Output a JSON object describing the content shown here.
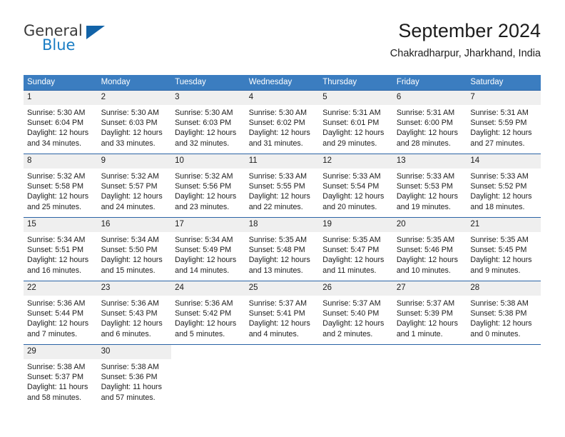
{
  "brand": {
    "name_part1": "General",
    "name_part2": "Blue",
    "triangle_color": "#1263a8",
    "blue_color": "#1a7dc4"
  },
  "header": {
    "title": "September 2024",
    "subtitle": "Chakradharpur, Jharkhand, India"
  },
  "theme": {
    "header_bg": "#3b7dc0",
    "row_border": "#2a63a5",
    "daynum_bg": "#efefef",
    "text": "#1c1c1c"
  },
  "weekday_headers": [
    "Sunday",
    "Monday",
    "Tuesday",
    "Wednesday",
    "Thursday",
    "Friday",
    "Saturday"
  ],
  "weeks": [
    [
      {
        "day": "1",
        "sunrise": "Sunrise: 5:30 AM",
        "sunset": "Sunset: 6:04 PM",
        "daylight": "Daylight: 12 hours and 34 minutes."
      },
      {
        "day": "2",
        "sunrise": "Sunrise: 5:30 AM",
        "sunset": "Sunset: 6:03 PM",
        "daylight": "Daylight: 12 hours and 33 minutes."
      },
      {
        "day": "3",
        "sunrise": "Sunrise: 5:30 AM",
        "sunset": "Sunset: 6:03 PM",
        "daylight": "Daylight: 12 hours and 32 minutes."
      },
      {
        "day": "4",
        "sunrise": "Sunrise: 5:30 AM",
        "sunset": "Sunset: 6:02 PM",
        "daylight": "Daylight: 12 hours and 31 minutes."
      },
      {
        "day": "5",
        "sunrise": "Sunrise: 5:31 AM",
        "sunset": "Sunset: 6:01 PM",
        "daylight": "Daylight: 12 hours and 29 minutes."
      },
      {
        "day": "6",
        "sunrise": "Sunrise: 5:31 AM",
        "sunset": "Sunset: 6:00 PM",
        "daylight": "Daylight: 12 hours and 28 minutes."
      },
      {
        "day": "7",
        "sunrise": "Sunrise: 5:31 AM",
        "sunset": "Sunset: 5:59 PM",
        "daylight": "Daylight: 12 hours and 27 minutes."
      }
    ],
    [
      {
        "day": "8",
        "sunrise": "Sunrise: 5:32 AM",
        "sunset": "Sunset: 5:58 PM",
        "daylight": "Daylight: 12 hours and 25 minutes."
      },
      {
        "day": "9",
        "sunrise": "Sunrise: 5:32 AM",
        "sunset": "Sunset: 5:57 PM",
        "daylight": "Daylight: 12 hours and 24 minutes."
      },
      {
        "day": "10",
        "sunrise": "Sunrise: 5:32 AM",
        "sunset": "Sunset: 5:56 PM",
        "daylight": "Daylight: 12 hours and 23 minutes."
      },
      {
        "day": "11",
        "sunrise": "Sunrise: 5:33 AM",
        "sunset": "Sunset: 5:55 PM",
        "daylight": "Daylight: 12 hours and 22 minutes."
      },
      {
        "day": "12",
        "sunrise": "Sunrise: 5:33 AM",
        "sunset": "Sunset: 5:54 PM",
        "daylight": "Daylight: 12 hours and 20 minutes."
      },
      {
        "day": "13",
        "sunrise": "Sunrise: 5:33 AM",
        "sunset": "Sunset: 5:53 PM",
        "daylight": "Daylight: 12 hours and 19 minutes."
      },
      {
        "day": "14",
        "sunrise": "Sunrise: 5:33 AM",
        "sunset": "Sunset: 5:52 PM",
        "daylight": "Daylight: 12 hours and 18 minutes."
      }
    ],
    [
      {
        "day": "15",
        "sunrise": "Sunrise: 5:34 AM",
        "sunset": "Sunset: 5:51 PM",
        "daylight": "Daylight: 12 hours and 16 minutes."
      },
      {
        "day": "16",
        "sunrise": "Sunrise: 5:34 AM",
        "sunset": "Sunset: 5:50 PM",
        "daylight": "Daylight: 12 hours and 15 minutes."
      },
      {
        "day": "17",
        "sunrise": "Sunrise: 5:34 AM",
        "sunset": "Sunset: 5:49 PM",
        "daylight": "Daylight: 12 hours and 14 minutes."
      },
      {
        "day": "18",
        "sunrise": "Sunrise: 5:35 AM",
        "sunset": "Sunset: 5:48 PM",
        "daylight": "Daylight: 12 hours and 13 minutes."
      },
      {
        "day": "19",
        "sunrise": "Sunrise: 5:35 AM",
        "sunset": "Sunset: 5:47 PM",
        "daylight": "Daylight: 12 hours and 11 minutes."
      },
      {
        "day": "20",
        "sunrise": "Sunrise: 5:35 AM",
        "sunset": "Sunset: 5:46 PM",
        "daylight": "Daylight: 12 hours and 10 minutes."
      },
      {
        "day": "21",
        "sunrise": "Sunrise: 5:35 AM",
        "sunset": "Sunset: 5:45 PM",
        "daylight": "Daylight: 12 hours and 9 minutes."
      }
    ],
    [
      {
        "day": "22",
        "sunrise": "Sunrise: 5:36 AM",
        "sunset": "Sunset: 5:44 PM",
        "daylight": "Daylight: 12 hours and 7 minutes."
      },
      {
        "day": "23",
        "sunrise": "Sunrise: 5:36 AM",
        "sunset": "Sunset: 5:43 PM",
        "daylight": "Daylight: 12 hours and 6 minutes."
      },
      {
        "day": "24",
        "sunrise": "Sunrise: 5:36 AM",
        "sunset": "Sunset: 5:42 PM",
        "daylight": "Daylight: 12 hours and 5 minutes."
      },
      {
        "day": "25",
        "sunrise": "Sunrise: 5:37 AM",
        "sunset": "Sunset: 5:41 PM",
        "daylight": "Daylight: 12 hours and 4 minutes."
      },
      {
        "day": "26",
        "sunrise": "Sunrise: 5:37 AM",
        "sunset": "Sunset: 5:40 PM",
        "daylight": "Daylight: 12 hours and 2 minutes."
      },
      {
        "day": "27",
        "sunrise": "Sunrise: 5:37 AM",
        "sunset": "Sunset: 5:39 PM",
        "daylight": "Daylight: 12 hours and 1 minute."
      },
      {
        "day": "28",
        "sunrise": "Sunrise: 5:38 AM",
        "sunset": "Sunset: 5:38 PM",
        "daylight": "Daylight: 12 hours and 0 minutes."
      }
    ],
    [
      {
        "day": "29",
        "sunrise": "Sunrise: 5:38 AM",
        "sunset": "Sunset: 5:37 PM",
        "daylight": "Daylight: 11 hours and 58 minutes."
      },
      {
        "day": "30",
        "sunrise": "Sunrise: 5:38 AM",
        "sunset": "Sunset: 5:36 PM",
        "daylight": "Daylight: 11 hours and 57 minutes."
      },
      {
        "day": "",
        "sunrise": "",
        "sunset": "",
        "daylight": ""
      },
      {
        "day": "",
        "sunrise": "",
        "sunset": "",
        "daylight": ""
      },
      {
        "day": "",
        "sunrise": "",
        "sunset": "",
        "daylight": ""
      },
      {
        "day": "",
        "sunrise": "",
        "sunset": "",
        "daylight": ""
      },
      {
        "day": "",
        "sunrise": "",
        "sunset": "",
        "daylight": ""
      }
    ]
  ]
}
